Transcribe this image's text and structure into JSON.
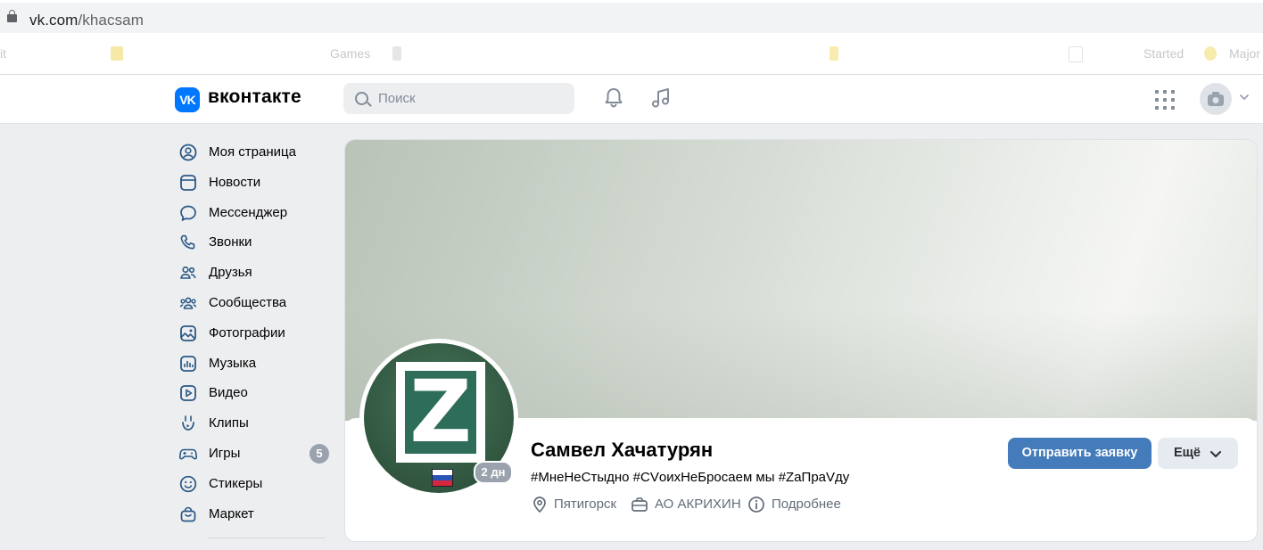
{
  "browser": {
    "url_host": "vk.com",
    "url_path": "/khacsam"
  },
  "bookmarks": [
    {
      "label": "it"
    },
    {
      "label": "Games"
    },
    {
      "label": "Started"
    },
    {
      "label": "Major"
    }
  ],
  "header": {
    "logo_text": "VK",
    "brand": "вконтакте",
    "search_placeholder": "Поиск",
    "accent_color": "#0077ff"
  },
  "menu": {
    "items": [
      {
        "label": "Моя страница",
        "icon": "user-circle-icon"
      },
      {
        "label": "Новости",
        "icon": "newsfeed-icon"
      },
      {
        "label": "Мессенджер",
        "icon": "message-icon"
      },
      {
        "label": "Звонки",
        "icon": "phone-icon"
      },
      {
        "label": "Друзья",
        "icon": "friends-icon"
      },
      {
        "label": "Сообщества",
        "icon": "communities-icon"
      },
      {
        "label": "Фотографии",
        "icon": "photo-icon"
      },
      {
        "label": "Музыка",
        "icon": "music-icon"
      },
      {
        "label": "Видео",
        "icon": "video-icon"
      },
      {
        "label": "Клипы",
        "icon": "clips-icon"
      },
      {
        "label": "Игры",
        "icon": "gamepad-icon",
        "badge": "5"
      },
      {
        "label": "Стикеры",
        "icon": "smile-icon"
      },
      {
        "label": "Маркет",
        "icon": "market-bag-icon"
      }
    ]
  },
  "profile": {
    "avatar_letter": "Z",
    "online_badge": "2 дн",
    "name": "Самвел Хачатурян",
    "status": "#МнеНеСтыдно #СVоихНеБросаем мы #ZaПраVду",
    "city": "Пятигорск",
    "work": "АО АКРИХИН",
    "details_label": "Подробнее",
    "send_request_label": "Отправить заявку",
    "more_label": "Ещё",
    "primary_button_color": "#447bba"
  }
}
